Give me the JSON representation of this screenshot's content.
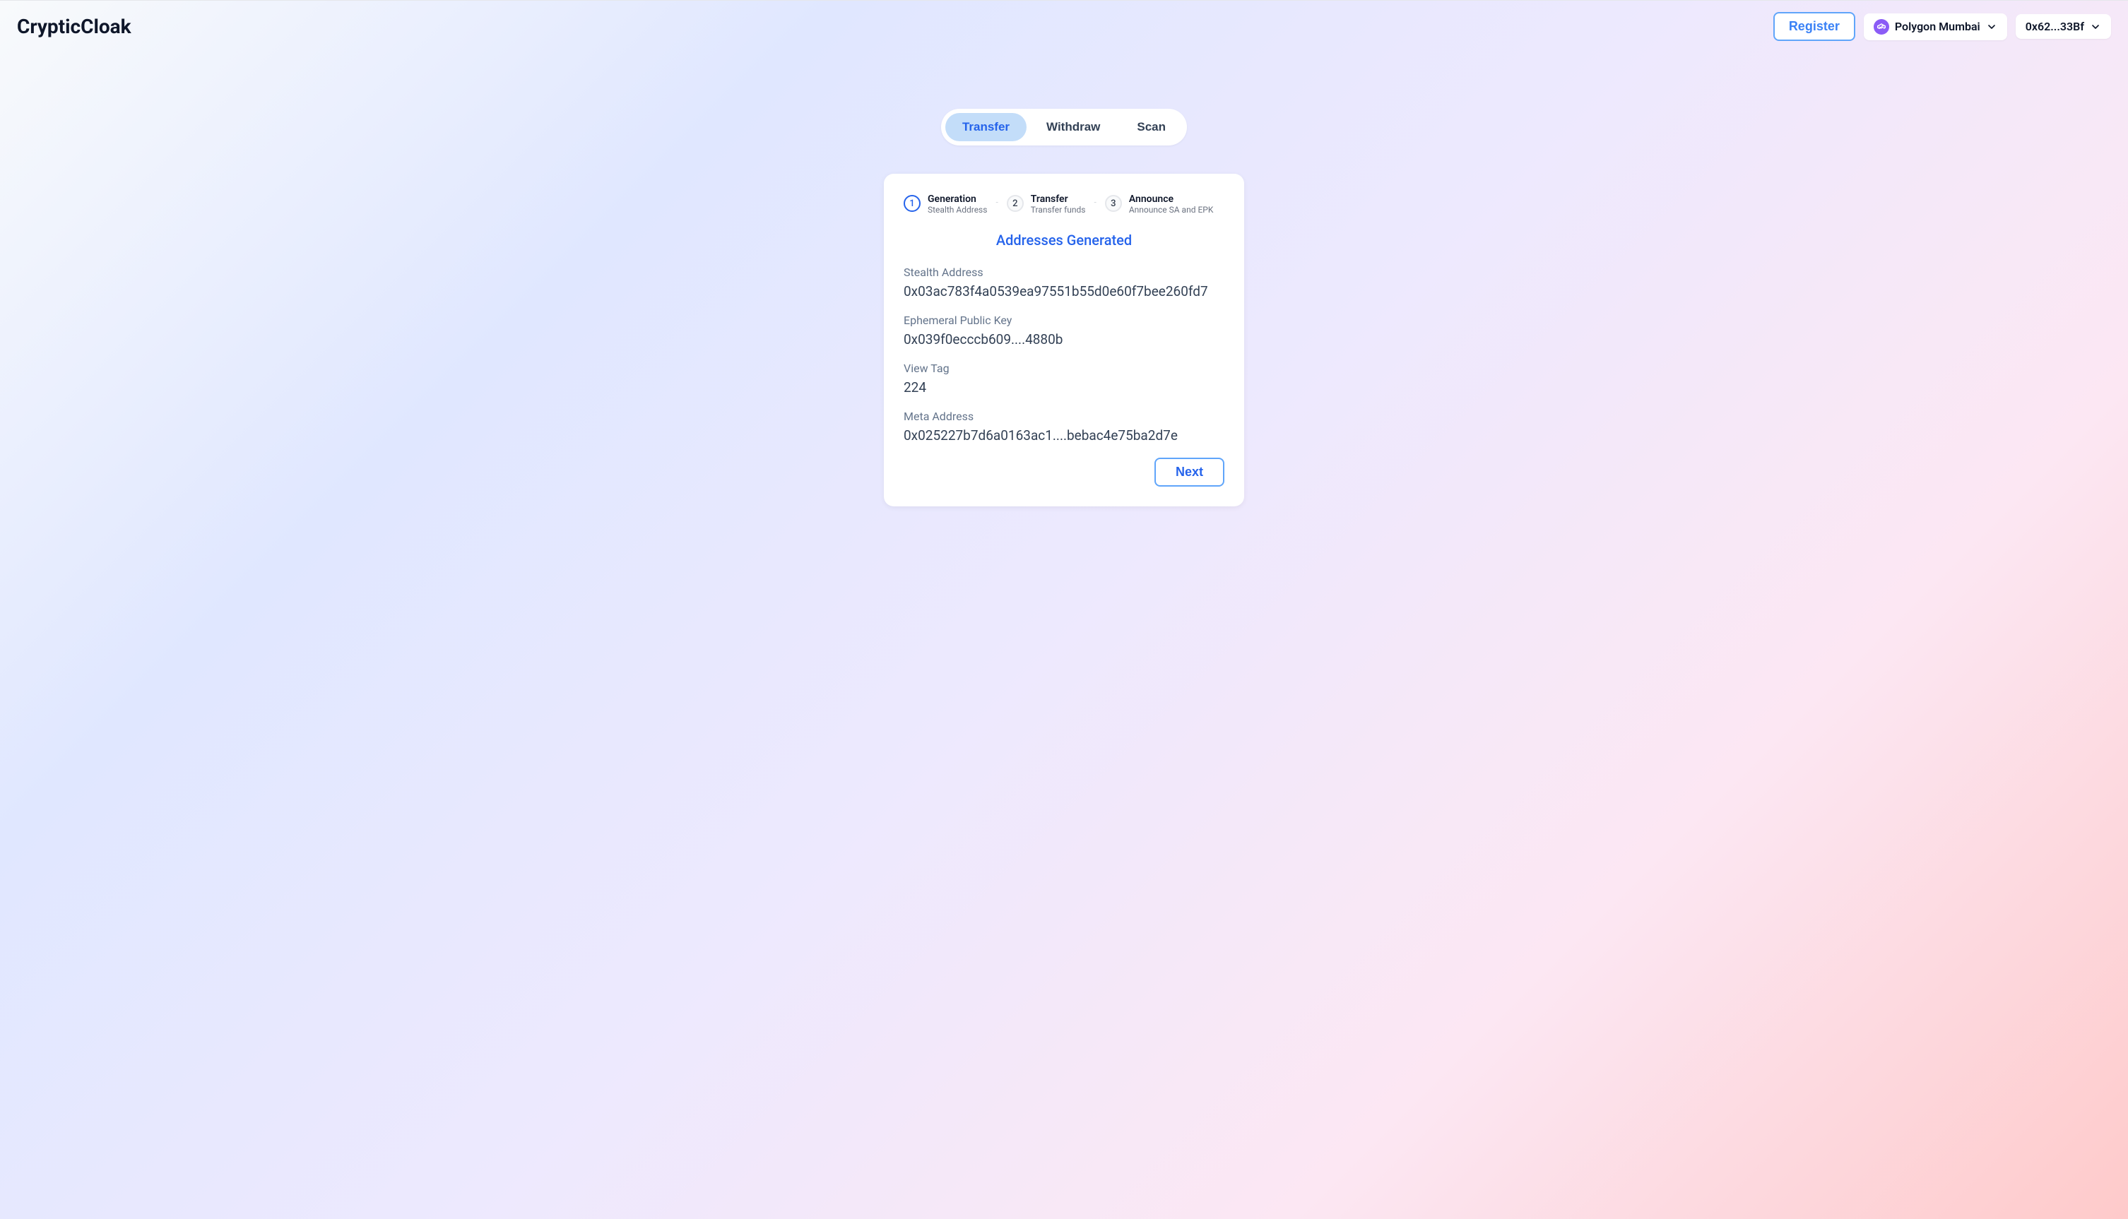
{
  "header": {
    "logo": "CrypticCloak",
    "register_label": "Register",
    "network_label": "Polygon Mumbai",
    "wallet_label": "0x62...33Bf"
  },
  "tabs": {
    "items": [
      {
        "label": "Transfer",
        "active": true
      },
      {
        "label": "Withdraw",
        "active": false
      },
      {
        "label": "Scan",
        "active": false
      }
    ]
  },
  "steps": [
    {
      "num": "1",
      "title": "Generation",
      "sub": "Stealth Address",
      "active": true
    },
    {
      "num": "2",
      "title": "Transfer",
      "sub": "Transfer funds",
      "active": false
    },
    {
      "num": "3",
      "title": "Announce",
      "sub": "Announce SA and EPK",
      "active": false
    }
  ],
  "section_heading": "Addresses Generated",
  "fields": [
    {
      "label": "Stealth Address",
      "value": "0x03ac783f4a0539ea97551b55d0e60f7bee260fd7"
    },
    {
      "label": "Ephemeral Public Key",
      "value": "0x039f0ecccb609....4880b"
    },
    {
      "label": "View Tag",
      "value": "224"
    },
    {
      "label": "Meta Address",
      "value": "0x025227b7d6a0163ac1....bebac4e75ba2d7e"
    }
  ],
  "next_label": "Next"
}
